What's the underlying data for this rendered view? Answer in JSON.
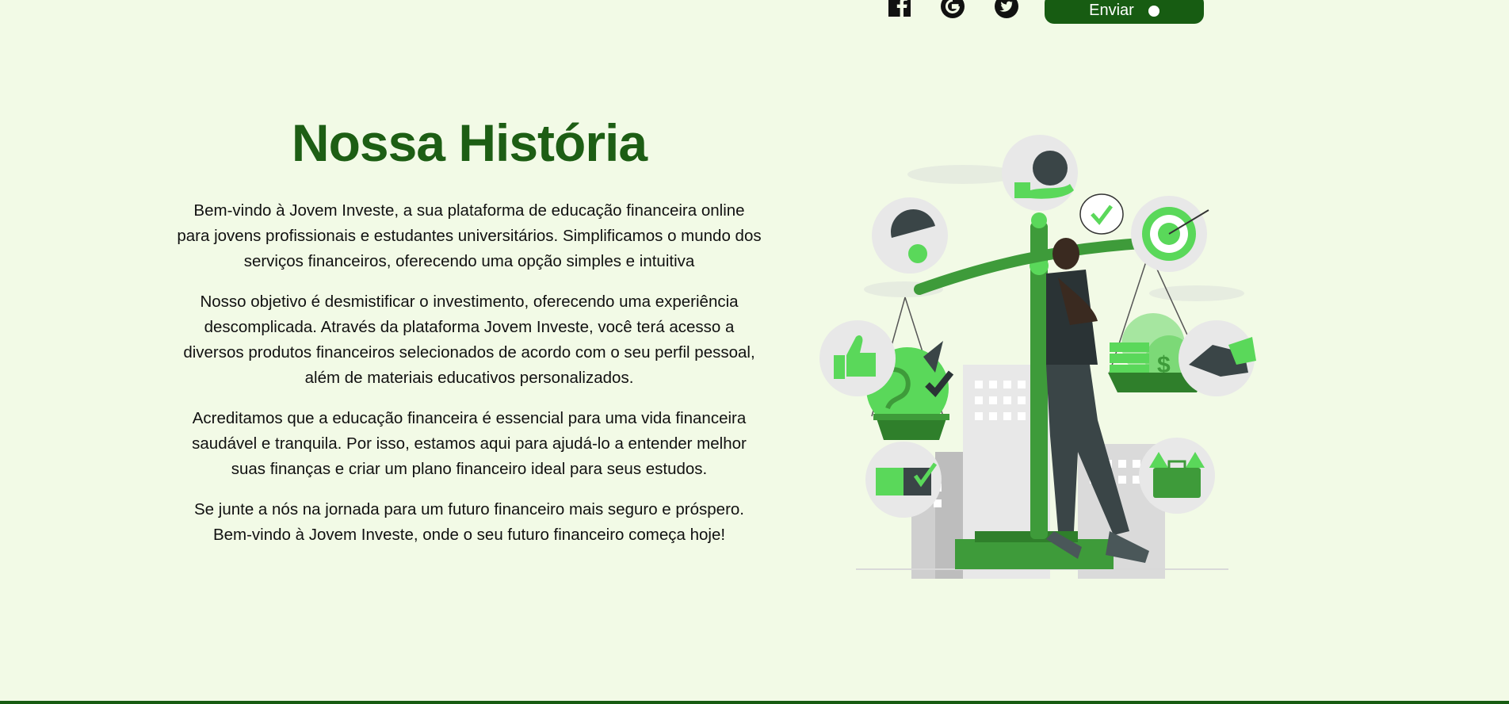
{
  "header": {
    "social": [
      {
        "icon": "facebook-icon"
      },
      {
        "icon": "google-icon"
      },
      {
        "icon": "twitter-icon"
      }
    ],
    "send_label": "Enviar"
  },
  "story": {
    "title": "Nossa História",
    "paragraphs": [
      "Bem-vindo à Jovem Investe, a sua plataforma de educação financeira online para jovens profissionais e estudantes universitários. Simplificamos o mundo dos serviços financeiros, oferecendo uma opção simples e intuitiva",
      "Nosso objetivo é desmistificar o investimento, oferecendo uma experiência descomplicada. Através da plataforma Jovem Investe, você terá acesso a diversos produtos financeiros selecionados de acordo com o seu perfil pessoal, além de materiais educativos personalizados.",
      "Acreditamos que a educação financeira é essencial para uma vida financeira saudável e tranquila. Por isso, estamos aqui para ajudá-lo a entender melhor suas finanças e criar um plano financeiro ideal para seus estudos.",
      "Se junte a nós na jornada para um futuro financeiro mais seguro e próspero. Bem-vindo à Jovem Investe, onde o seu futuro financeiro começa hoje!"
    ]
  },
  "colors": {
    "background": "#f2fae6",
    "brand_green": "#175c12",
    "title_green": "#1d5e14",
    "accent_green": "#5ad85a"
  },
  "illustration": {
    "icon": "investment-balance-illustration"
  }
}
